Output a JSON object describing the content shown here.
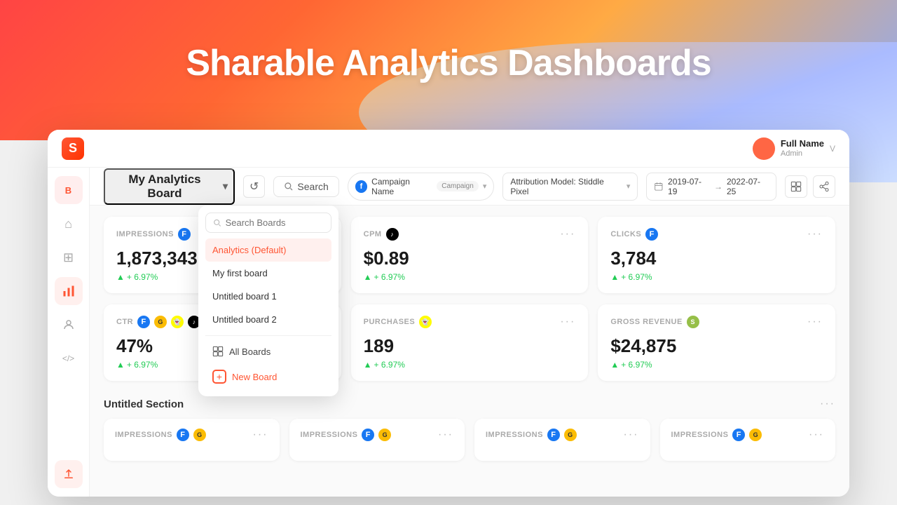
{
  "hero": {
    "title": "Sharable Analytics Dashboards"
  },
  "topbar": {
    "logo": "S",
    "user": {
      "name": "Full Name",
      "role": "Admin",
      "initial": "V"
    }
  },
  "sidebar": {
    "top_item": "B",
    "items": [
      {
        "id": "home",
        "icon": "⌂",
        "active": false
      },
      {
        "id": "grid",
        "icon": "⊞",
        "active": false
      },
      {
        "id": "analytics",
        "icon": "📊",
        "active": true
      },
      {
        "id": "users",
        "icon": "👤",
        "active": false
      },
      {
        "id": "code",
        "icon": "</>",
        "active": false
      },
      {
        "id": "upload",
        "icon": "↑",
        "active": false
      }
    ]
  },
  "toolbar": {
    "board_title": "My Analytics Board",
    "refresh_icon": "↺",
    "search_label": "Search",
    "campaign_filter": {
      "platform": "f",
      "name": "Campaign Name",
      "tag": "Campaign"
    },
    "attribution": "Attribution Model: Stiddle Pixel",
    "date_from": "2019-07-19",
    "date_to": "2022-07-25",
    "chevron": "▾"
  },
  "dropdown": {
    "search_placeholder": "Search Boards",
    "items": [
      {
        "label": "Analytics (Default)",
        "active": true
      },
      {
        "label": "My first board",
        "active": false
      },
      {
        "label": "Untitled board 1",
        "active": false
      },
      {
        "label": "Untitled board 2",
        "active": false
      }
    ],
    "all_boards_label": "All Boards",
    "new_board_label": "New Board"
  },
  "metrics_row1": [
    {
      "label": "IMPRESSIONS",
      "platform": "fb",
      "value": "1,873,343",
      "change": "+ 6.97%"
    },
    {
      "label": "CPM",
      "platform": "tiktok",
      "value": "$0.89",
      "change": "+ 6.97%"
    },
    {
      "label": "CLICKS",
      "platform": "fb",
      "value": "3,784",
      "change": "+ 6.97%"
    }
  ],
  "metrics_row2": [
    {
      "label": "CTR",
      "platforms": [
        "fb",
        "ga",
        "snap",
        "tiktok"
      ],
      "value": "47%",
      "change": "+ 6.97%"
    },
    {
      "label": "PURCHASES",
      "platforms": [
        "snap"
      ],
      "value": "189",
      "change": "+ 6.97%"
    },
    {
      "label": "GROSS REVENUE",
      "platforms": [
        "shopify"
      ],
      "value": "$24,875",
      "change": "+ 6.97%"
    }
  ],
  "section": {
    "title": "Untitled Section"
  },
  "bottom_row": [
    {
      "label": "IMPRESSIONS",
      "platforms": [
        "fb",
        "ga"
      ]
    },
    {
      "label": "IMPRESSIONS",
      "platforms": [
        "fb",
        "ga"
      ]
    },
    {
      "label": "IMPRESSIONS",
      "platforms": [
        "fb",
        "ga"
      ]
    },
    {
      "label": "IMPRESSIONS",
      "platforms": [
        "fb",
        "ga"
      ]
    }
  ]
}
